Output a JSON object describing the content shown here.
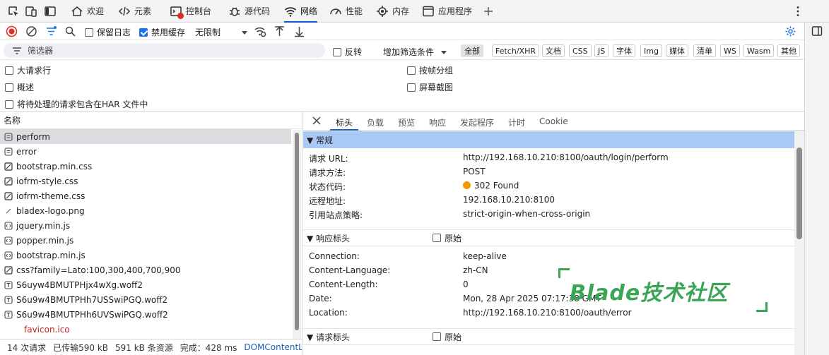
{
  "tabs": [
    {
      "label": "欢迎",
      "icon": "home-icon"
    },
    {
      "label": "元素",
      "icon": "code-icon"
    },
    {
      "label": "控制台",
      "icon": "console-icon"
    },
    {
      "label": "源代码",
      "icon": "bug-icon"
    },
    {
      "label": "网络",
      "icon": "wifi-icon"
    },
    {
      "label": "性能",
      "icon": "performance-icon"
    },
    {
      "label": "内存",
      "icon": "memory-icon"
    },
    {
      "label": "应用程序",
      "icon": "application-icon"
    }
  ],
  "toolbar": {
    "preserve_log": "保留日志",
    "disable_cache": "禁用缓存",
    "throttle": "无限制"
  },
  "filter": {
    "placeholder": "筛选器",
    "invert": "反转",
    "more_filters": "增加筛选条件",
    "types": [
      "全部",
      "Fetch/XHR",
      "文档",
      "CSS",
      "JS",
      "字体",
      "Img",
      "媒体",
      "清单",
      "WS",
      "Wasm",
      "其他"
    ]
  },
  "options": {
    "big_rows": "大请求行",
    "overview": "概述",
    "har_pending": "将待处理的请求包含在HAR 文件中",
    "group_by_frame": "按帧分组",
    "screenshots": "屏幕截图"
  },
  "list": {
    "header": "名称",
    "items": [
      {
        "name": "perform",
        "icon": "document-icon"
      },
      {
        "name": "error",
        "icon": "document-icon"
      },
      {
        "name": "bootstrap.min.css",
        "icon": "stylesheet-icon"
      },
      {
        "name": "iofrm-style.css",
        "icon": "stylesheet-icon"
      },
      {
        "name": "iofrm-theme.css",
        "icon": "stylesheet-icon"
      },
      {
        "name": "bladex-logo.png",
        "icon": "image-icon"
      },
      {
        "name": "jquery.min.js",
        "icon": "script-icon"
      },
      {
        "name": "popper.min.js",
        "icon": "script-icon"
      },
      {
        "name": "bootstrap.min.js",
        "icon": "script-icon"
      },
      {
        "name": "css?family=Lato:100,300,400,700,900",
        "icon": "stylesheet-icon"
      },
      {
        "name": "S6uyw4BMUTPHjx4wXg.woff2",
        "icon": "font-icon"
      },
      {
        "name": "S6u9w4BMUTPHh7USSwiPGQ.woff2",
        "icon": "font-icon"
      },
      {
        "name": "S6u9w4BMUTPHh6UVSwiPGQ.woff2",
        "icon": "font-icon"
      },
      {
        "name": "favicon.ico",
        "icon": ""
      }
    ]
  },
  "status": {
    "requests": "14 次请求",
    "transferred": "已传输590 kB",
    "resources": "591 kB 条资源",
    "finish": "完成：428 ms",
    "dcl": "DOMContentLoa"
  },
  "detail": {
    "tabs": [
      "标头",
      "负载",
      "预览",
      "响应",
      "发起程序",
      "计时",
      "Cookie"
    ],
    "general": {
      "title": "▼ 常规",
      "rows": [
        {
          "k": "请求 URL:",
          "v": "http://192.168.10.210:8100/oauth/login/perform"
        },
        {
          "k": "请求方法:",
          "v": "POST"
        },
        {
          "k": "状态代码:",
          "v": "302 Found"
        },
        {
          "k": "远程地址:",
          "v": "192.168.10.210:8100"
        },
        {
          "k": "引用站点策略:",
          "v": "strict-origin-when-cross-origin"
        }
      ]
    },
    "response_headers": {
      "title": "▼ 响应标头",
      "raw": "原始",
      "rows": [
        {
          "k": "Connection:",
          "v": "keep-alive"
        },
        {
          "k": "Content-Language:",
          "v": "zh-CN"
        },
        {
          "k": "Content-Length:",
          "v": "0"
        },
        {
          "k": "Date:",
          "v": "Mon, 28 Apr 2025 07:17:38 GMT"
        },
        {
          "k": "Location:",
          "v": "http://192.168.10.210:8100/oauth/error"
        }
      ]
    },
    "request_headers": {
      "title": "▼ 请求标头",
      "raw": "原始"
    }
  },
  "watermark": "Blade技术社区",
  "colors": {
    "accent": "#0b5cd5",
    "selected_row": "#dadce0",
    "section_blue": "#a9c8f5",
    "status_dot": "#f29900",
    "watermark": "#3aa655"
  }
}
